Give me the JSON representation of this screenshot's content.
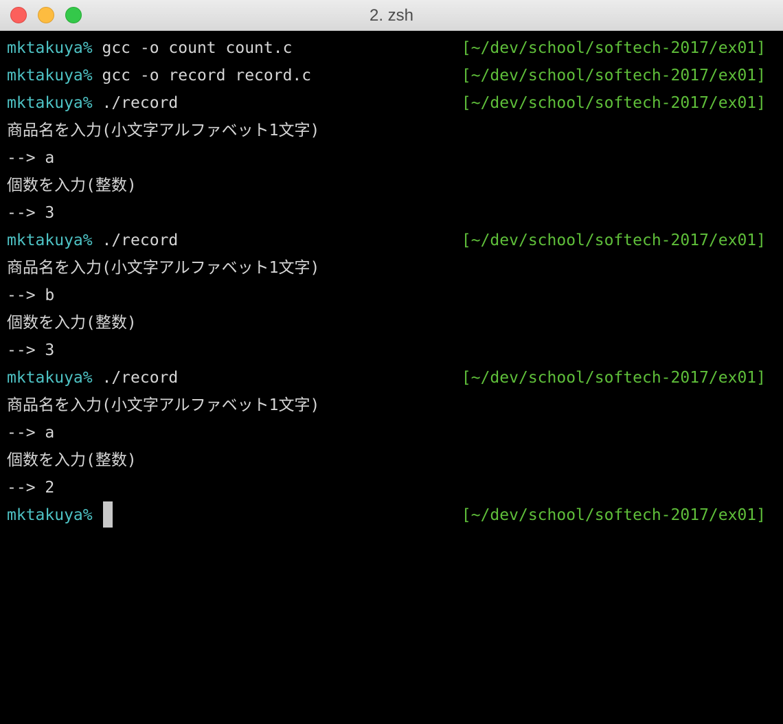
{
  "window": {
    "title": "2. zsh"
  },
  "terminal": {
    "prompt": "mktakuya%",
    "rprompt": "[~/dev/school/softech-2017/ex01]",
    "lines": [
      {
        "type": "cmd",
        "text": "gcc -o count count.c"
      },
      {
        "type": "cmd",
        "text": "gcc -o record record.c"
      },
      {
        "type": "cmd",
        "text": "./record"
      },
      {
        "type": "out",
        "text": "商品名を入力(小文字アルファベット1文字)"
      },
      {
        "type": "out",
        "text": "--> a"
      },
      {
        "type": "out",
        "text": "個数を入力(整数)"
      },
      {
        "type": "out",
        "text": "--> 3"
      },
      {
        "type": "cmd",
        "text": "./record"
      },
      {
        "type": "out",
        "text": "商品名を入力(小文字アルファベット1文字)"
      },
      {
        "type": "out",
        "text": "--> b"
      },
      {
        "type": "out",
        "text": "個数を入力(整数)"
      },
      {
        "type": "out",
        "text": "--> 3"
      },
      {
        "type": "cmd",
        "text": "./record"
      },
      {
        "type": "out",
        "text": "商品名を入力(小文字アルファベット1文字)"
      },
      {
        "type": "out",
        "text": "--> a"
      },
      {
        "type": "out",
        "text": "個数を入力(整数)"
      },
      {
        "type": "out",
        "text": "--> 2"
      },
      {
        "type": "cursor",
        "text": ""
      }
    ]
  },
  "colors": {
    "background": "#000000",
    "prompt": "#4ec3c5",
    "rprompt": "#5fbf3a",
    "text": "#d6d6d6"
  }
}
